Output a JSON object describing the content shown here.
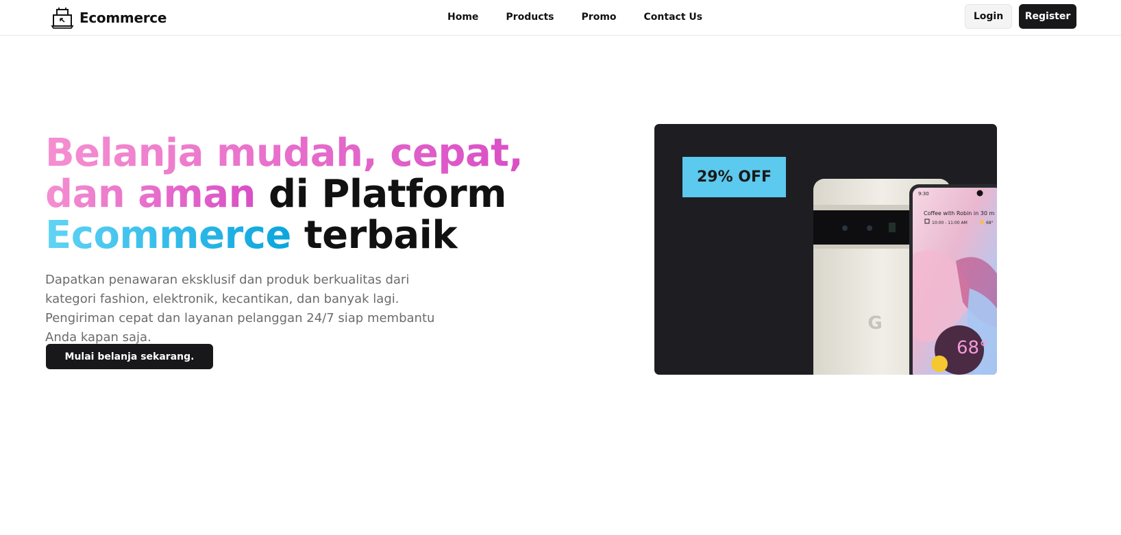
{
  "header": {
    "brand": "Ecommerce",
    "nav": [
      "Home",
      "Products",
      "Promo",
      "Contact Us"
    ],
    "login_label": "Login",
    "register_label": "Register"
  },
  "hero": {
    "title_part1": "Belanja mudah, cepat,",
    "title_part2": "dan aman",
    "title_part3": " di Platform",
    "title_part4": "Ecommerce",
    "title_part5": " terbaik",
    "description": "Dapatkan penawaran eksklusif dan produk berkualitas dari kategori fashion, elektronik, kecantikan, dan banyak lagi. Pengiriman cepat dan layanan pelanggan 24/7 siap membantu Anda kapan saja.",
    "cta_label": "Mulai belanja sekarang."
  },
  "promo": {
    "discount_label": "29% OFF",
    "phone_time": "9:30",
    "phone_event": "Coffee with Robin in 30 m",
    "phone_event_time": "10:00 - 11:00 AM",
    "phone_temp": "68°",
    "phone_temp_small": "68°"
  },
  "colors": {
    "accent_pink": "#d94fc6",
    "accent_cyan": "#0aa5dd",
    "dark": "#18181b",
    "discount_bg": "#5cc9ee"
  }
}
